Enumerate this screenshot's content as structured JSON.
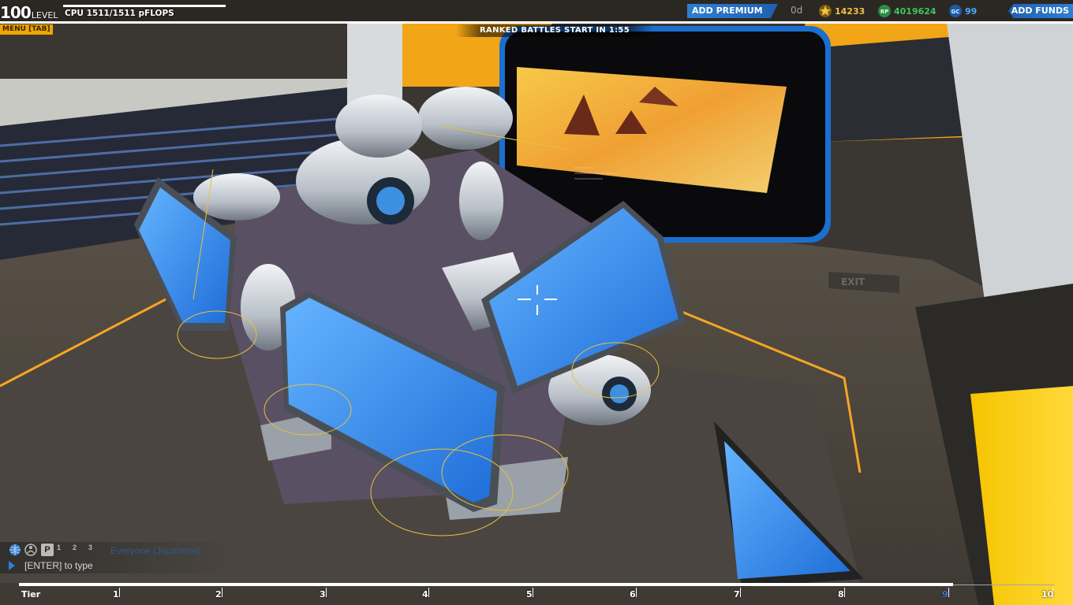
{
  "player": {
    "level_number": "100",
    "level_word": "LEVEL",
    "cpu": "CPU 1511/1511 pFLOPS"
  },
  "menu": {
    "label": "MENU [TAB]"
  },
  "banner": {
    "ranked": "RANKED BATTLES START IN 1:55"
  },
  "premium": {
    "button": "ADD PREMIUM",
    "days": "0d"
  },
  "currencies": {
    "rp": "14233",
    "robits": "4019624",
    "gc": "99"
  },
  "funds": {
    "button": "ADD FUNDS"
  },
  "scene": {
    "exit_sign": "EXIT"
  },
  "chat": {
    "channel": "Everyone (Japanese)",
    "input_placeholder": "[ENTER] to type",
    "icons": [
      "globe-icon",
      "person-icon",
      "party-icon",
      "user-1-icon",
      "user-2-icon",
      "user-3-icon"
    ],
    "badges": [
      "P",
      "1",
      "2",
      "3"
    ]
  },
  "tier": {
    "label": "Tier",
    "ticks": [
      "1",
      "2",
      "3",
      "4",
      "5",
      "6",
      "7",
      "8",
      "9",
      "10"
    ],
    "current": "9"
  },
  "colors": {
    "accent_blue": "#2f7fd1",
    "rp_gold": "#f3c23a",
    "robits_green": "#42c45b",
    "gc_blue": "#4aa9ff",
    "menu_orange": "#f0a500"
  }
}
